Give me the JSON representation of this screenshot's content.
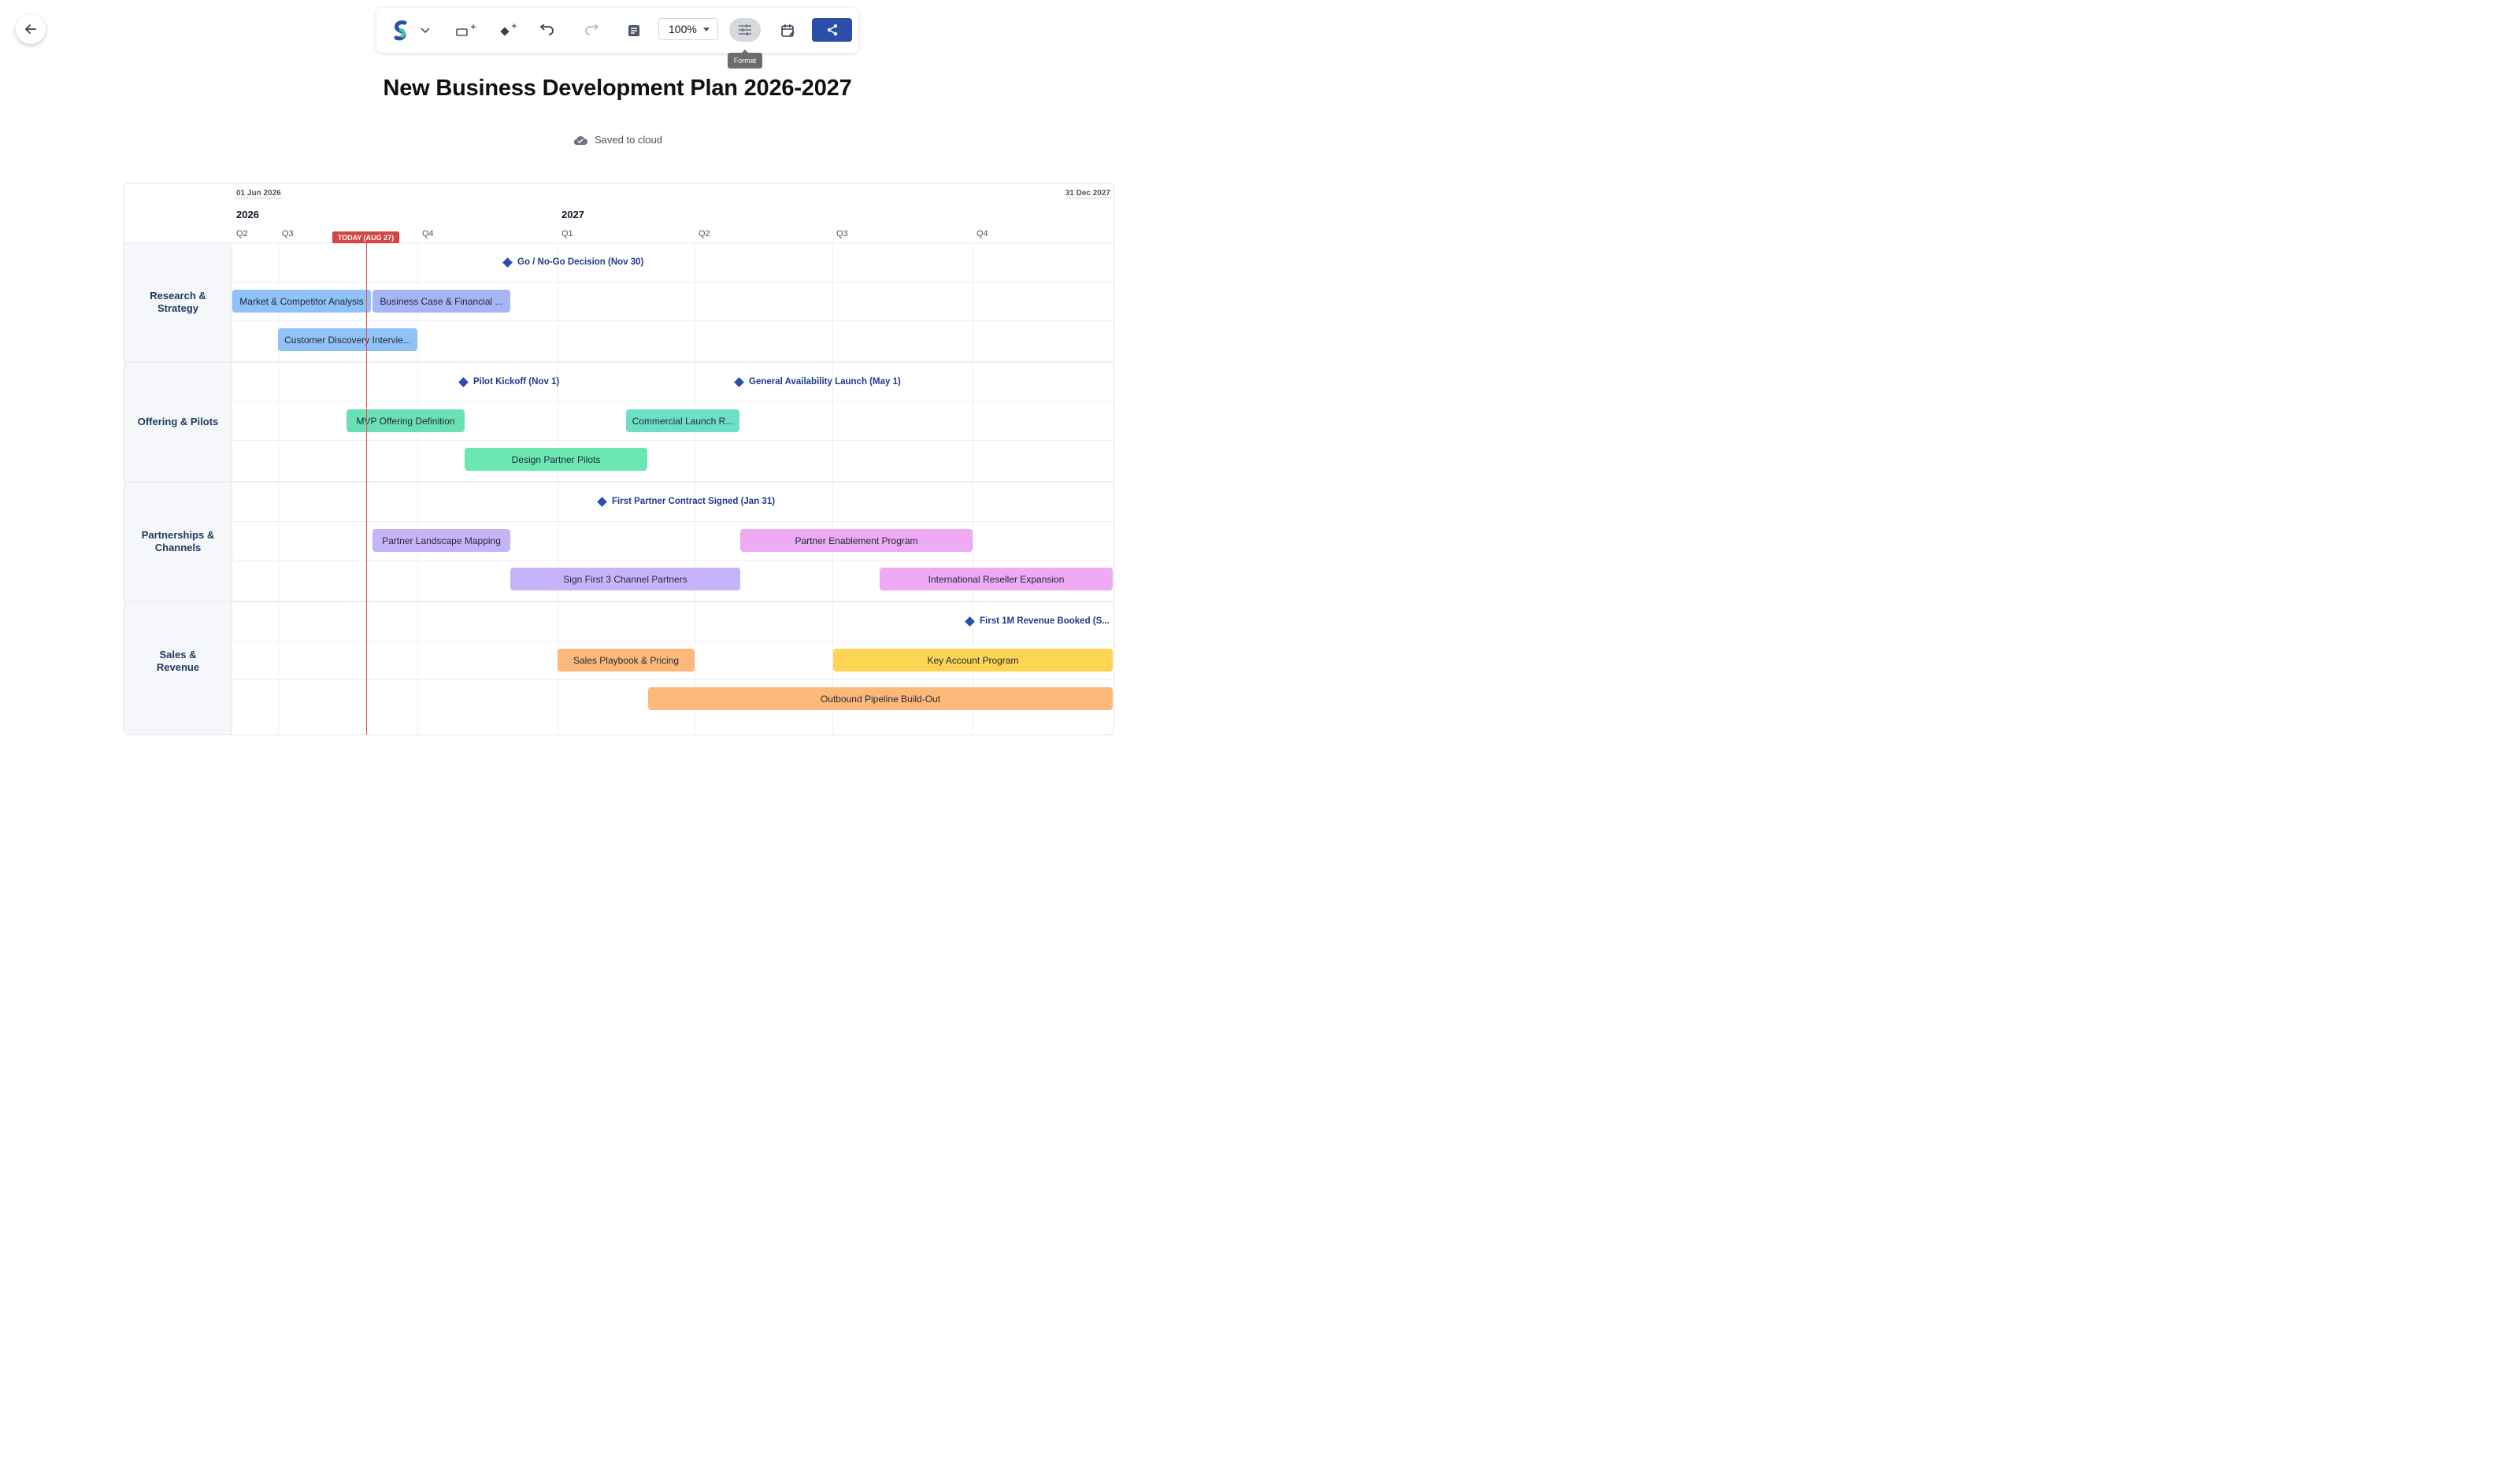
{
  "toolbar": {
    "zoom": "100%",
    "format_tooltip": "Format"
  },
  "title": "New Business Development Plan 2026-2027",
  "status": "Saved to cloud",
  "timeline": {
    "start_date": "01 Jun 2026",
    "end_date": "31 Dec 2027",
    "years": [
      "2026",
      "2027"
    ],
    "quarters": [
      "Q2",
      "Q3",
      "Q4",
      "Q1",
      "Q2",
      "Q3",
      "Q4"
    ],
    "today": "TODAY (AUG 27)"
  },
  "groups": [
    {
      "label": "Research & Strategy",
      "milestones": [
        {
          "label": "Go / No-Go Decision (Nov 30)"
        }
      ],
      "tasks": [
        {
          "label": "Market & Competitor Analysis",
          "color": "#90c2f7"
        },
        {
          "label": "Business Case & Financial ...",
          "color": "#a7b4f5"
        },
        {
          "label": "Customer Discovery Intervie...",
          "color": "#90c2f7"
        }
      ]
    },
    {
      "label": "Offering & Pilots",
      "milestones": [
        {
          "label": "Pilot Kickoff (Nov 1)"
        },
        {
          "label": "General Availability Launch (May 1)"
        }
      ],
      "tasks": [
        {
          "label": "MVP Offering Definition",
          "color": "#6be0b4"
        },
        {
          "label": "Commercial Launch R...",
          "color": "#6be0c6"
        },
        {
          "label": "Design Partner Pilots",
          "color": "#6be8b2"
        }
      ]
    },
    {
      "label": "Partnerships & Channels",
      "milestones": [
        {
          "label": "First Partner Contract Signed (Jan 31)"
        }
      ],
      "tasks": [
        {
          "label": "Partner Landscape Mapping",
          "color": "#c5b5f8"
        },
        {
          "label": "Partner Enablement Program",
          "color": "#eeaaf3"
        },
        {
          "label": "Sign First 3 Channel Partners",
          "color": "#c5b5f8"
        },
        {
          "label": "International Reseller Expansion",
          "color": "#eeaaf3"
        }
      ]
    },
    {
      "label": "Sales & Revenue",
      "milestones": [
        {
          "label": "First 1M Revenue Booked (S..."
        }
      ],
      "tasks": [
        {
          "label": "Sales Playbook & Pricing",
          "color": "#fcb97a"
        },
        {
          "label": "Key Account Program",
          "color": "#fdd553"
        },
        {
          "label": "Outbound Pipeline Build-Out",
          "color": "#fcb97a"
        }
      ]
    }
  ]
}
